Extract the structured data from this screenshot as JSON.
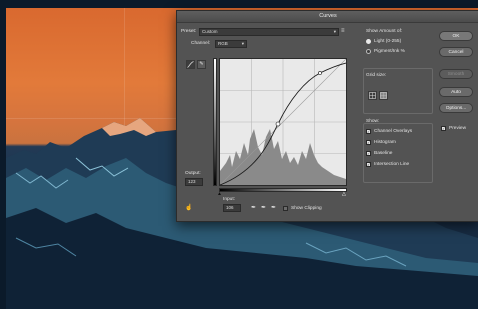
{
  "dialog": {
    "title": "Curves",
    "preset_label": "Preset:",
    "preset_value": "Custom",
    "channel_label": "Channel:",
    "channel_value": "RGB",
    "output_label": "Output:",
    "output_value": "123",
    "input_label": "Input:",
    "input_value": "106",
    "show_clipping": "Show Clipping",
    "show_amount_label": "Show Amount of:",
    "light_option": "Light  (0-255)",
    "pigment_option": "Pigment/Ink %",
    "grid_size_label": "Grid size:",
    "show_label": "Show:",
    "channel_overlays": "Channel Overlays",
    "histogram": "Histogram",
    "baseline": "Baseline",
    "intersection_line": "Intersection Line",
    "buttons": {
      "ok": "OK",
      "cancel": "Cancel",
      "smooth": "Smooth",
      "auto": "Auto",
      "options": "Options..."
    },
    "preview": "Preview",
    "icons": {
      "curve_tool": "curve-tool-icon",
      "pencil_tool": "pencil-tool-icon",
      "hand_tool": "targeted-adjustment-icon",
      "dropper_black": "black-point-eyedropper-icon",
      "dropper_gray": "gray-point-eyedropper-icon",
      "dropper_white": "white-point-eyedropper-icon",
      "menu": "preset-options-icon"
    },
    "checked": {
      "channel_overlays": true,
      "histogram": true,
      "baseline": true,
      "intersection_line": true,
      "preview": true,
      "show_clipping": false
    },
    "selected_amount": "light"
  }
}
